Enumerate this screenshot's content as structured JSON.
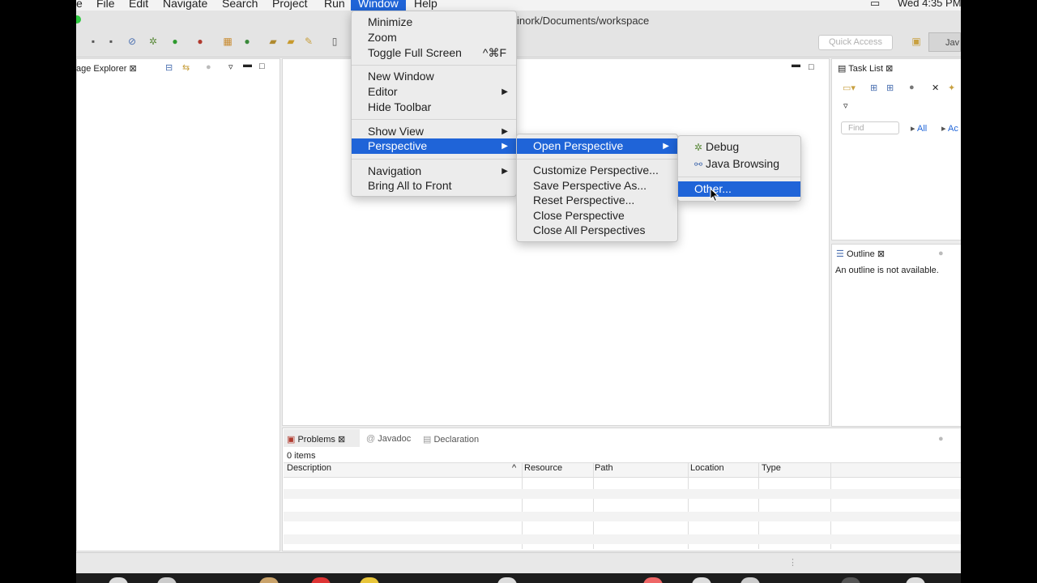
{
  "menubar": {
    "items": [
      "e",
      "File",
      "Edit",
      "Navigate",
      "Search",
      "Project",
      "Run",
      "Window",
      "Help"
    ],
    "clock": "Wed 4:35 PM"
  },
  "window": {
    "title": "inork/Documents/workspace"
  },
  "toolbar": {
    "quick_access_placeholder": "Quick Access",
    "perspective_label": "Jav"
  },
  "package_explorer": {
    "tab_label": "age Explorer"
  },
  "task_list": {
    "tab_label": "Task List",
    "find_placeholder": "Find",
    "all_label": "All",
    "a_label": "Ac"
  },
  "outline": {
    "tab_label": "Outline",
    "message": "An outline is not available."
  },
  "problems": {
    "tabs": [
      "Problems",
      "Javadoc",
      "Declaration"
    ],
    "count": "0 items",
    "columns": [
      "Description",
      "Resource",
      "Path",
      "Location",
      "Type"
    ]
  },
  "window_menu": {
    "items": [
      "Minimize",
      "Zoom",
      "Toggle Full Screen",
      "New Window",
      "Editor",
      "Hide Toolbar",
      "Show View",
      "Perspective",
      "Navigation",
      "Bring All to Front"
    ],
    "fullscreen_shortcut": "^⌘F"
  },
  "perspective_menu": {
    "items": [
      "Open Perspective",
      "Customize Perspective...",
      "Save Perspective As...",
      "Reset Perspective...",
      "Close Perspective",
      "Close All Perspectives"
    ]
  },
  "open_perspective_menu": {
    "items": [
      "Debug",
      "Java Browsing",
      "Other..."
    ]
  },
  "colors": {
    "accent": "#1f64d8",
    "background": "#ececec"
  }
}
